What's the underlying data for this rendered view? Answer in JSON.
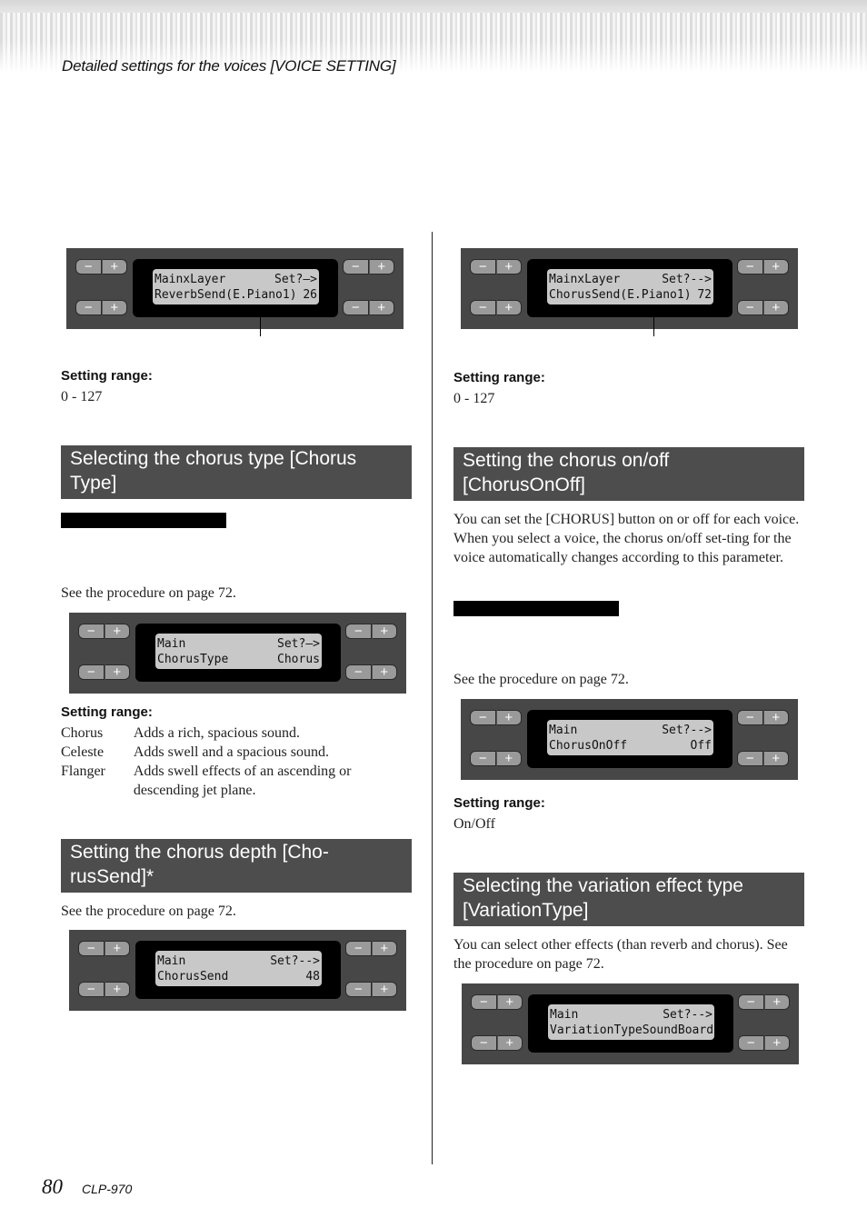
{
  "running_head": "Detailed settings for the voices [VOICE SETTING]",
  "footer": {
    "page_number": "80",
    "model": "CLP-970"
  },
  "button_glyphs": {
    "minus": "−",
    "plus": "+"
  },
  "left_column": {
    "reverb_send": {
      "lcd": {
        "line1_left": "MainxLayer",
        "line1_right": "Set?—>",
        "line2_left": "ReverbSend(E.Piano1)",
        "line2_right": "26"
      },
      "range_label": "Setting range:",
      "range_value": "0 - 127"
    },
    "chorus_type": {
      "heading": "Selecting the chorus type [Chorus Type]",
      "procedure": "See the procedure on page 72.",
      "lcd": {
        "line1_left": "Main",
        "line1_right": "Set?—>",
        "line2_left": "ChorusType",
        "line2_right": "Chorus"
      },
      "range_label": "Setting range:",
      "options": [
        {
          "name": "Chorus",
          "desc": "Adds a rich, spacious sound."
        },
        {
          "name": "Celeste",
          "desc": "Adds swell and a spacious sound."
        },
        {
          "name": "Flanger",
          "desc": "Adds swell effects of an ascending or descending jet plane."
        }
      ]
    },
    "chorus_depth": {
      "heading": "Setting the chorus depth [Cho-rusSend]*",
      "procedure": "See the procedure on page 72.",
      "lcd": {
        "line1_left": "Main",
        "line1_right": "Set?-->",
        "line2_left": "ChorusSend",
        "line2_right": "48"
      }
    }
  },
  "right_column": {
    "chorus_send": {
      "lcd": {
        "line1_left": "MainxLayer",
        "line1_right": "Set?-->",
        "line2_left": "ChorusSend(E.Piano1)",
        "line2_right": "72"
      },
      "range_label": "Setting range:",
      "range_value": "0 - 127"
    },
    "chorus_onoff": {
      "heading": "Setting the chorus on/off [ChorusOnOff]",
      "description": "You can set the [CHORUS] button on or off for each voice. When you select a voice, the chorus on/off set-ting for the voice automatically changes according to this parameter.",
      "procedure": "See the procedure on page 72.",
      "lcd": {
        "line1_left": "Main",
        "line1_right": "Set?-->",
        "line2_left": "ChorusOnOff",
        "line2_right": "Off"
      },
      "range_label": "Setting range:",
      "range_value": "On/Off"
    },
    "variation_type": {
      "heading": "Selecting the variation effect type [VariationType]",
      "description": "You can select other effects (than reverb and chorus). See the procedure on page 72.",
      "lcd": {
        "line1_left": "Main",
        "line1_right": "Set?-->",
        "line2_left": "VariationType",
        "line2_right": "SoundBoard"
      }
    }
  }
}
